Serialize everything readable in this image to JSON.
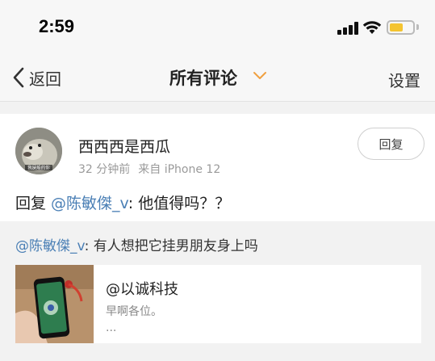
{
  "status_bar": {
    "time": "2:59",
    "battery_color": "#f4c430"
  },
  "nav": {
    "back_label": "返回",
    "title": "所有评论",
    "settings_label": "设置",
    "chevron_color": "#f0a040"
  },
  "post": {
    "username": "西西西是西瓜",
    "time_ago": "32 分钟前",
    "source": "来自 iPhone 12",
    "reply_button": "回复",
    "comment": {
      "prefix": "回复 ",
      "mention": "@陈敏傑_v",
      "text": ": 他值得吗？？"
    },
    "avatar_caption": "我屎般的你"
  },
  "quote": {
    "mention": "@陈敏傑_v",
    "text": ": 有人想把它挂男朋友身上吗"
  },
  "link_card": {
    "title": "@以诚科技",
    "description": "早啊各位。",
    "more": "..."
  },
  "colors": {
    "mention": "#4a7fb5"
  }
}
